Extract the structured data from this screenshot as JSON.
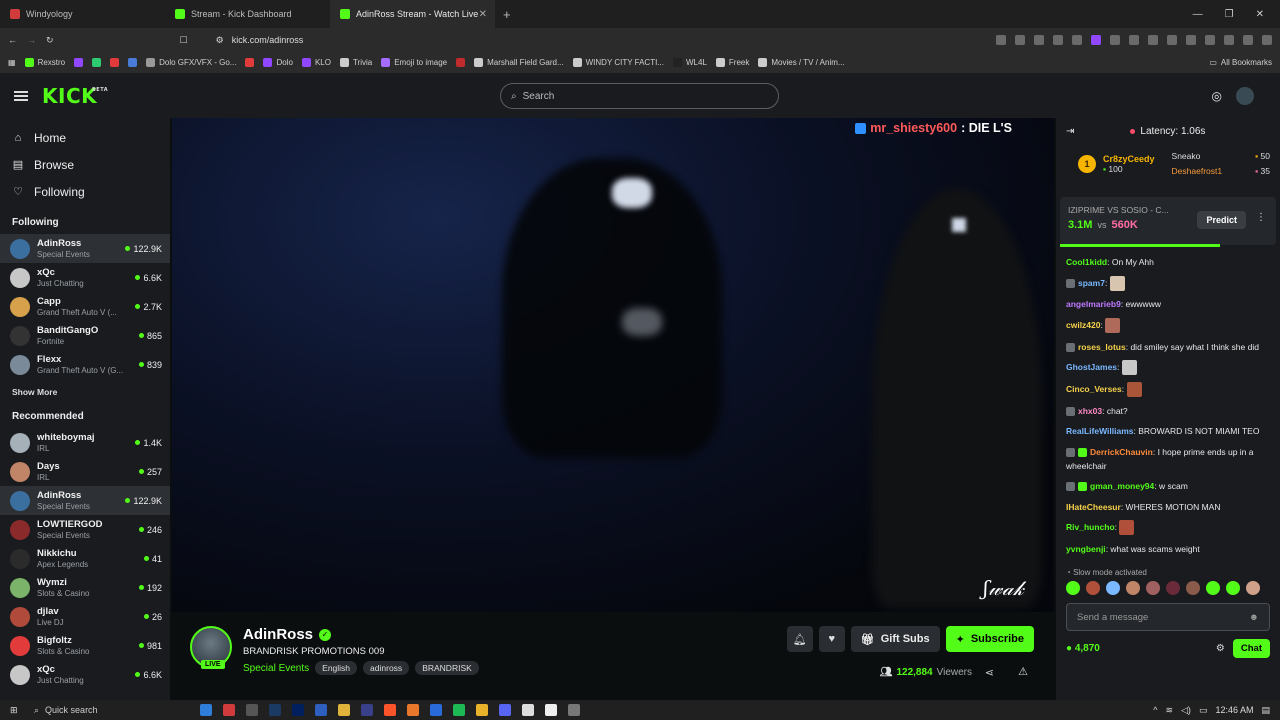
{
  "browser": {
    "tabs": [
      {
        "title": "Windyology",
        "color": "#d23b3b"
      },
      {
        "title": "Stream - Kick Dashboard",
        "color": "#53fc18"
      },
      {
        "title": "AdinRoss Stream - Watch Live",
        "color": "#53fc18",
        "active": true
      }
    ],
    "url": "kick.com/adinross",
    "bookmarks": [
      {
        "label": "Rexstro",
        "color": "#53fc18"
      },
      {
        "label": "",
        "color": "#9146ff"
      },
      {
        "label": "",
        "color": "#2ecc71"
      },
      {
        "label": "Dolo GFX/VFX - Go...",
        "color": "#999999"
      },
      {
        "label": "Dolo",
        "color": "#9146ff"
      },
      {
        "label": "KLO",
        "color": "#9146ff"
      },
      {
        "label": "Trivia",
        "color": "#cccccc"
      },
      {
        "label": "Emoji to image",
        "color": "#a66bff"
      },
      {
        "label": "Marshall Field Gard...",
        "color": "#cccccc"
      },
      {
        "label": "WINDY CITY FACTI...",
        "color": "#cccccc"
      },
      {
        "label": "WL4L",
        "color": "#222222"
      },
      {
        "label": "Freek",
        "color": "#cccccc"
      },
      {
        "label": "Movies / TV / Anim...",
        "color": "#cccccc"
      }
    ],
    "all_bookmarks": "All Bookmarks"
  },
  "header": {
    "logo": "KICK",
    "logo_sup": "BETA",
    "search_placeholder": "Search"
  },
  "sidebar": {
    "nav": [
      {
        "label": "Home",
        "icon": "⌂"
      },
      {
        "label": "Browse",
        "icon": "▤"
      },
      {
        "label": "Following",
        "icon": "♡"
      }
    ],
    "following_title": "Following",
    "following": [
      {
        "name": "AdinRoss",
        "category": "Special Events",
        "viewers": "122.9K",
        "color": "#3b6fa0",
        "selected": true
      },
      {
        "name": "xQc",
        "category": "Just Chatting",
        "viewers": "6.6K",
        "color": "#c7c7c7"
      },
      {
        "name": "Capp",
        "category": "Grand Theft Auto V (...",
        "viewers": "2.7K",
        "color": "#d6a14a"
      },
      {
        "name": "BanditGangO",
        "category": "Fortnite",
        "viewers": "865",
        "color": "#333333"
      },
      {
        "name": "Flexx",
        "category": "Grand Theft Auto V (G...",
        "viewers": "839",
        "color": "#7a8a99"
      }
    ],
    "show_more": "Show More",
    "recommended_title": "Recommended",
    "recommended": [
      {
        "name": "whiteboymaj",
        "category": "IRL",
        "viewers": "1.4K",
        "color": "#a5b0b8"
      },
      {
        "name": "Days",
        "category": "IRL",
        "viewers": "257",
        "color": "#c08466"
      },
      {
        "name": "AdinRoss",
        "category": "Special Events",
        "viewers": "122.9K",
        "color": "#3b6fa0",
        "selected": true
      },
      {
        "name": "LOWTIERGOD",
        "category": "Special Events",
        "viewers": "246",
        "color": "#8a2a2a"
      },
      {
        "name": "Nikkichu",
        "category": "Apex Legends",
        "viewers": "41",
        "color": "#2b2b2b"
      },
      {
        "name": "Wymzi",
        "category": "Slots & Casino",
        "viewers": "192",
        "color": "#7bb36b"
      },
      {
        "name": "djlav",
        "category": "Live DJ",
        "viewers": "26",
        "color": "#b04a3a"
      },
      {
        "name": "Bigfoltz",
        "category": "Slots & Casino",
        "viewers": "981",
        "color": "#e23b3b"
      },
      {
        "name": "xQc",
        "category": "Just Chatting",
        "viewers": "6.6K",
        "color": "#c7c7c7"
      }
    ]
  },
  "video": {
    "overlay_user": "mr_shiesty600",
    "overlay_text": ": DIE L'S"
  },
  "stream": {
    "name": "AdinRoss",
    "live": "LIVE",
    "title": "BRANDRISK PROMOTIONS 009",
    "category": "Special Events",
    "tags": [
      "English",
      "adinross",
      "BRANDRISK"
    ],
    "gift_label": "Gift Subs",
    "subscribe_label": "Subscribe",
    "viewers": "122,884",
    "viewers_label": "Viewers"
  },
  "chat": {
    "latency": "Latency: 1.06s",
    "leaderboard": {
      "top_rank": "1",
      "top_name": "Cr8zyCeedy",
      "top_score": "100",
      "list": [
        {
          "name": "Sneako",
          "value": "50"
        },
        {
          "name": "Deshaefrost1",
          "value": "35"
        }
      ]
    },
    "prediction": {
      "title": "IZIPRIME VS SOSIO - C...",
      "a": "3.1M",
      "vs": "vs",
      "b": "560K",
      "button": "Predict"
    },
    "messages": [
      {
        "user": "Cool1kidd",
        "text": "On My Ahh",
        "color": "#53fc18"
      },
      {
        "user": "spam7",
        "text": "",
        "color": "#7ab8ff",
        "emote": "#d8c5b0"
      },
      {
        "user": "angelmarieb9",
        "text": "ewwwww",
        "color": "#c07aff"
      },
      {
        "user": "cwilz420",
        "text": "",
        "color": "#f7d14a",
        "emote": "#b06a5a"
      },
      {
        "user": "roses_lotus",
        "text": "did smiley say what I think she did",
        "color": "#f7d14a"
      },
      {
        "user": "GhostJames",
        "text": "",
        "color": "#7ab8ff",
        "emote": "#c8c8c8"
      },
      {
        "user": "Cinco_Verses",
        "text": "",
        "color": "#f7d14a",
        "emote": "#a8553a"
      },
      {
        "user": "xhx03",
        "text": "chat?",
        "color": "#ff8bc5"
      },
      {
        "user": "RealLifeWilliams",
        "text": "BROWARD IS NOT MIAMI TEO",
        "color": "#7ab8ff"
      },
      {
        "user": "DerrickChauvin",
        "text": "I hope prime ends up in a wheelchair",
        "color": "#ff8a3a"
      },
      {
        "user": "gman_money94",
        "text": "w scam",
        "color": "#53fc18"
      },
      {
        "user": "IHateCheesur",
        "text": "WHERES MOTION MAN",
        "color": "#f7d14a"
      },
      {
        "user": "Riv_huncho",
        "text": "",
        "color": "#53fc18",
        "emote": "#b0503a"
      },
      {
        "user": "yvngbenji",
        "text": "what was scams weight",
        "color": "#53fc18"
      }
    ],
    "slow_mode": "Slow mode activated",
    "send_placeholder": "Send a message",
    "points": "4,870",
    "chat_button": "Chat"
  },
  "taskbar": {
    "search": "Quick search",
    "time": "12:46 AM"
  }
}
